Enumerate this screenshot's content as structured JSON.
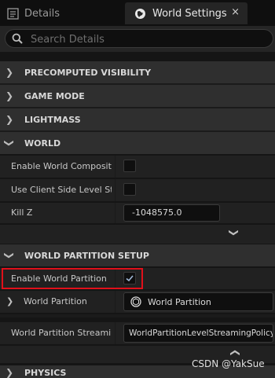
{
  "tabs": {
    "details_label": "Details",
    "world_settings_label": "World Settings",
    "close_glyph": "×"
  },
  "search": {
    "placeholder": "Search Details"
  },
  "sections": {
    "precomputed_visibility": "PRECOMPUTED VISIBILITY",
    "game_mode": "GAME MODE",
    "lightmass": "LIGHTMASS",
    "world": "WORLD",
    "world_partition_setup": "WORLD PARTITION SETUP",
    "physics": "PHYSICS"
  },
  "world": {
    "enable_world_composition_label": "Enable World Composition",
    "use_client_side_label": "Use Client Side Level Streaming Volumes",
    "kill_z_label": "Kill Z",
    "kill_z_value": "-1048575.0"
  },
  "world_partition_setup": {
    "enable_world_partition_label": "Enable World Partition",
    "enable_world_partition_checked": true,
    "world_partition_label": "World Partition",
    "world_partition_value": "World Partition",
    "streaming_label": "World Partition Streaming",
    "streaming_value": "WorldPartitionLevelStreamingPolicy"
  },
  "watermark": "CSDN @YakSue",
  "colors": {
    "highlight": "#e0101a",
    "background": "#151515"
  },
  "icons": {
    "details_tab": "details-icon",
    "world_settings_tab": "globe-icon",
    "search": "search-icon"
  }
}
